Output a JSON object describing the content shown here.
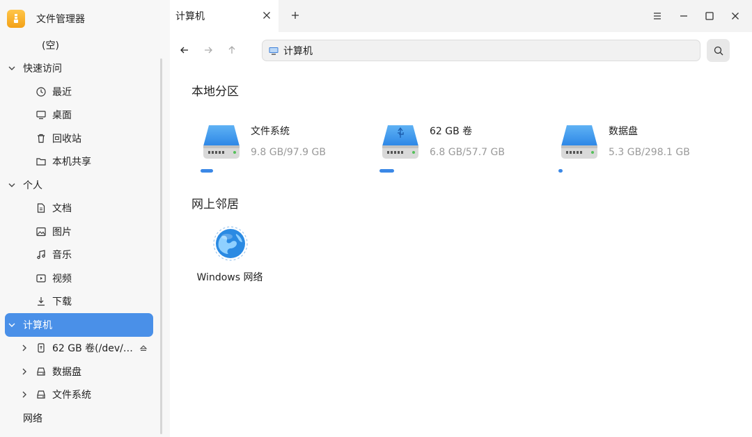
{
  "app": {
    "title": "文件管理器"
  },
  "sidebar": {
    "empty_label": "(空)",
    "quick_access": {
      "label": "快速访问",
      "items": [
        {
          "label": "最近",
          "icon": "clock-icon"
        },
        {
          "label": "桌面",
          "icon": "desktop-icon"
        },
        {
          "label": "回收站",
          "icon": "trash-icon"
        },
        {
          "label": "本机共享",
          "icon": "folder-icon"
        }
      ]
    },
    "personal": {
      "label": "个人",
      "items": [
        {
          "label": "文档",
          "icon": "document-icon"
        },
        {
          "label": "图片",
          "icon": "image-icon"
        },
        {
          "label": "音乐",
          "icon": "music-icon"
        },
        {
          "label": "视频",
          "icon": "video-icon"
        },
        {
          "label": "下载",
          "icon": "download-icon"
        }
      ]
    },
    "computer": {
      "label": "计算机",
      "items": [
        {
          "label": "62 GB 卷(/dev/…",
          "icon": "usb-drive-icon"
        },
        {
          "label": "数据盘",
          "icon": "hard-disk-icon"
        },
        {
          "label": "文件系统",
          "icon": "hard-disk-icon"
        }
      ]
    },
    "network": {
      "label": "网络"
    }
  },
  "tabs": [
    {
      "label": "计算机"
    }
  ],
  "address": {
    "path": "计算机"
  },
  "sections": {
    "local": "本地分区",
    "network": "网上邻居"
  },
  "drives": [
    {
      "name": "文件系统",
      "size": "9.8 GB/97.9 GB",
      "used_fraction": 0.1,
      "usb": false
    },
    {
      "name": "62 GB 卷",
      "size": "6.8 GB/57.7 GB",
      "used_fraction": 0.118,
      "usb": true
    },
    {
      "name": "数据盘",
      "size": "5.3 GB/298.1 GB",
      "used_fraction": 0.018,
      "usb": false
    }
  ],
  "network_items": [
    {
      "label": "Windows 网络",
      "icon": "globe-icon"
    }
  ],
  "colors": {
    "accent": "#4a90e8",
    "usage_bar": "#3b88e6"
  }
}
